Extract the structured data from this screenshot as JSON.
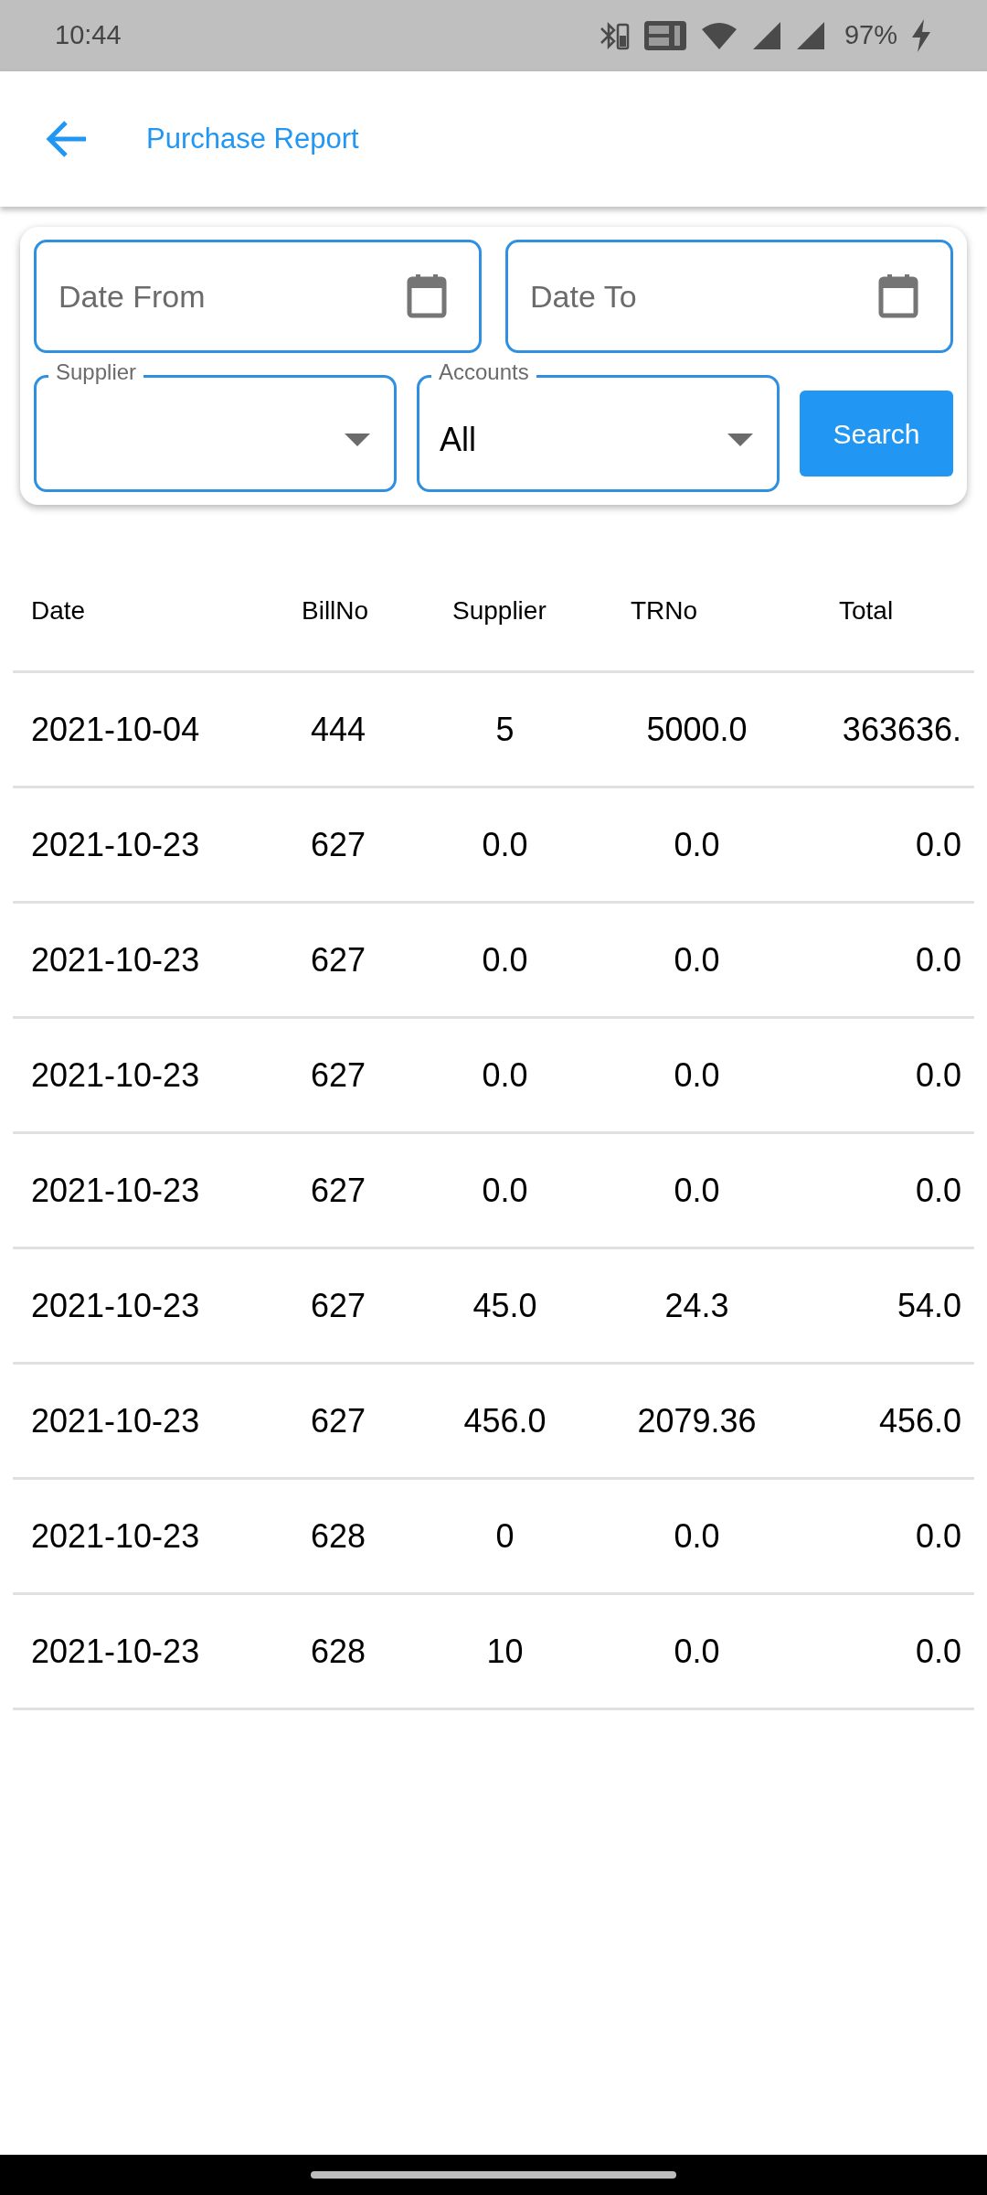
{
  "status_bar": {
    "time": "10:44",
    "battery": "97%"
  },
  "app_bar": {
    "title": "Purchase Report"
  },
  "filters": {
    "date_from": {
      "placeholder": "Date From"
    },
    "date_to": {
      "placeholder": "Date To"
    },
    "supplier": {
      "label": "Supplier"
    },
    "accounts": {
      "label": "Accounts",
      "value": "All"
    },
    "search_button": "Search"
  },
  "table": {
    "columns": [
      "Date",
      "BillNo",
      "Supplier",
      "TRNo",
      "Total"
    ],
    "rows": [
      [
        "2021-10-04",
        "444",
        "5",
        "5000.0",
        "363636."
      ],
      [
        "2021-10-23",
        "627",
        "0.0",
        "0.0",
        "0.0"
      ],
      [
        "2021-10-23",
        "627",
        "0.0",
        "0.0",
        "0.0"
      ],
      [
        "2021-10-23",
        "627",
        "0.0",
        "0.0",
        "0.0"
      ],
      [
        "2021-10-23",
        "627",
        "0.0",
        "0.0",
        "0.0"
      ],
      [
        "2021-10-23",
        "627",
        "45.0",
        "24.3",
        "54.0"
      ],
      [
        "2021-10-23",
        "627",
        "456.0",
        "2079.36",
        "456.0"
      ],
      [
        "2021-10-23",
        "628",
        "0",
        "0.0",
        "0.0"
      ],
      [
        "2021-10-23",
        "628",
        "10",
        "0.0",
        "0.0"
      ]
    ]
  }
}
